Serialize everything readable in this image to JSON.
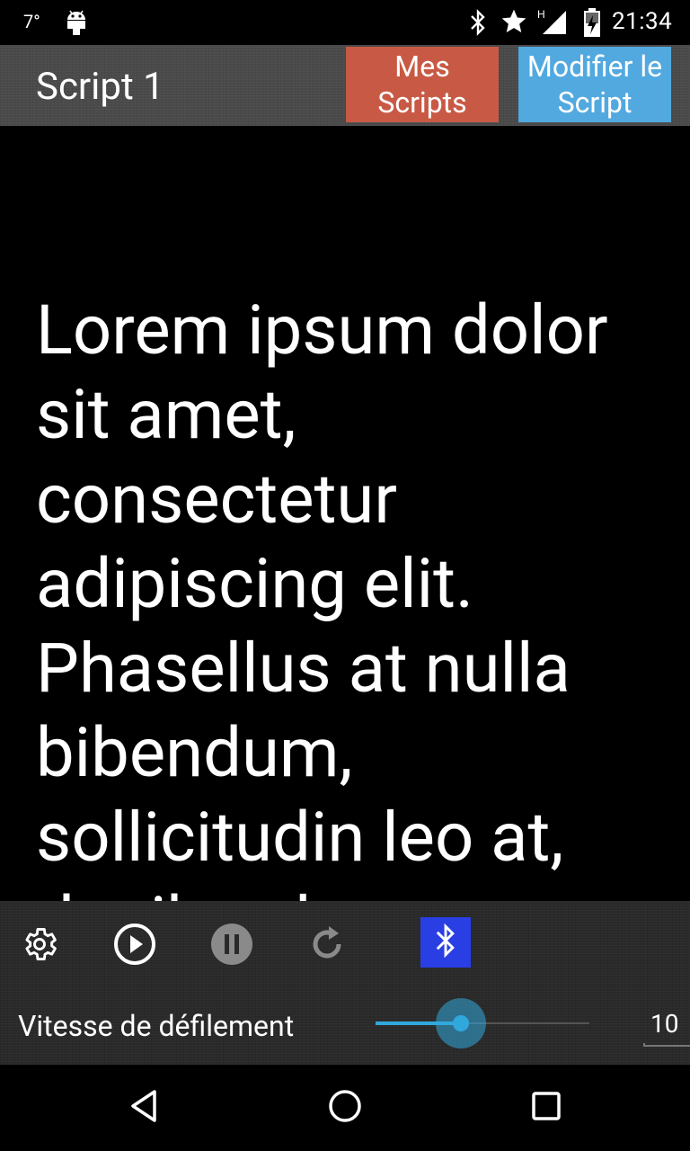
{
  "status_bar": {
    "temperature": "7°",
    "time": "21:34",
    "network_type": "H",
    "icons": [
      "android-icon",
      "bluetooth-icon",
      "star-icon",
      "signal-icon",
      "battery-charging-icon"
    ]
  },
  "action_bar": {
    "title": "Script 1",
    "my_scripts_label": "Mes Scripts",
    "edit_script_label": "Modifier le Script",
    "my_scripts_color": "#c85a45",
    "edit_script_color": "#52a9df"
  },
  "content": {
    "script_text": "Lorem ipsum dolor sit amet, consectetur adipiscing elit. Phasellus at nulla bibendum, sollicitudin leo at, dapibus lacus"
  },
  "controls": {
    "icons": [
      "gear-icon",
      "play-icon",
      "pause-icon",
      "reset-icon",
      "bluetooth-icon"
    ],
    "bluetooth_color": "#2a3fe3",
    "speed_label": "Vitesse de défilement",
    "speed_value": "10",
    "speed_fraction": 0.4,
    "accent_color": "#31a8dc"
  },
  "nav_bar": {
    "icons": [
      "back-icon",
      "home-icon",
      "recent-apps-icon"
    ]
  }
}
